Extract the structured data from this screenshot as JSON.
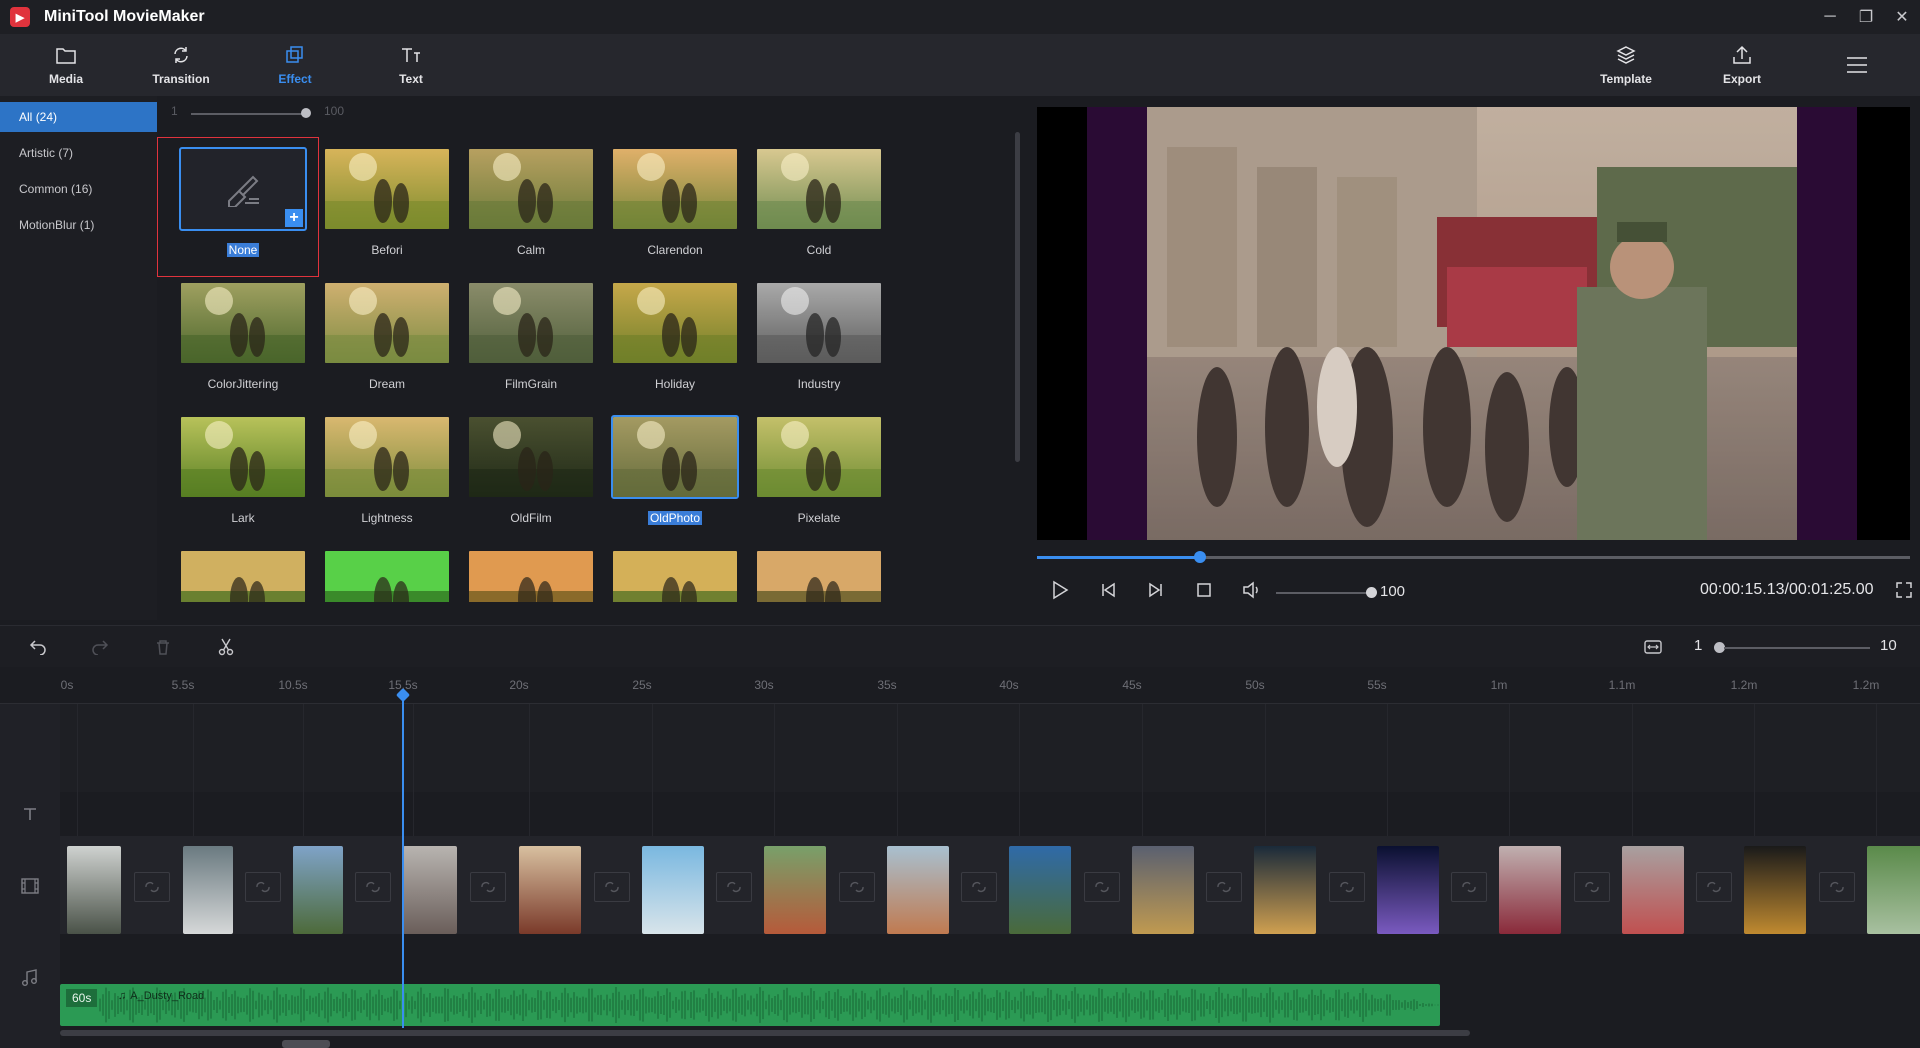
{
  "app": {
    "title": "MiniTool MovieMaker"
  },
  "window": {
    "minimize": "─",
    "restore": "❐",
    "close": "✕"
  },
  "toolbar": {
    "media": "Media",
    "transition": "Transition",
    "effect": "Effect",
    "text": "Text",
    "template": "Template",
    "export": "Export"
  },
  "categories": [
    {
      "label": "All",
      "count": "(24)"
    },
    {
      "label": "Artistic",
      "count": "(7)"
    },
    {
      "label": "Common",
      "count": "(16)"
    },
    {
      "label": "MotionBlur",
      "count": "(1)"
    }
  ],
  "intensity": {
    "min": "1",
    "max": "100",
    "value": 100
  },
  "effects": [
    "None",
    "Befori",
    "Calm",
    "Clarendon",
    "Cold",
    "ColorJittering",
    "Dream",
    "FilmGrain",
    "Holiday",
    "Industry",
    "Lark",
    "Lightness",
    "OldFilm",
    "OldPhoto",
    "Pixelate"
  ],
  "selected_effect": "OldPhoto",
  "player": {
    "volume": "100",
    "volume_level": 100,
    "timecode": "00:00:15.13/00:01:25.00",
    "progress_fraction": 0.18
  },
  "timeline": {
    "zoom_min": "1",
    "zoom_max": "10",
    "ruler": [
      "0s",
      "5.5s",
      "10.5s",
      "15.5s",
      "20s",
      "25s",
      "30s",
      "35s",
      "40s",
      "45s",
      "50s",
      "55s",
      "1m",
      "1.1m",
      "1.2m",
      "1.2m"
    ],
    "audio": {
      "duration": "60s",
      "name": "A_Dusty_Road"
    }
  },
  "colors": {
    "accent": "#3a8ef0",
    "selection_outline": "#e0333d",
    "audio_track": "#2b9a54"
  }
}
